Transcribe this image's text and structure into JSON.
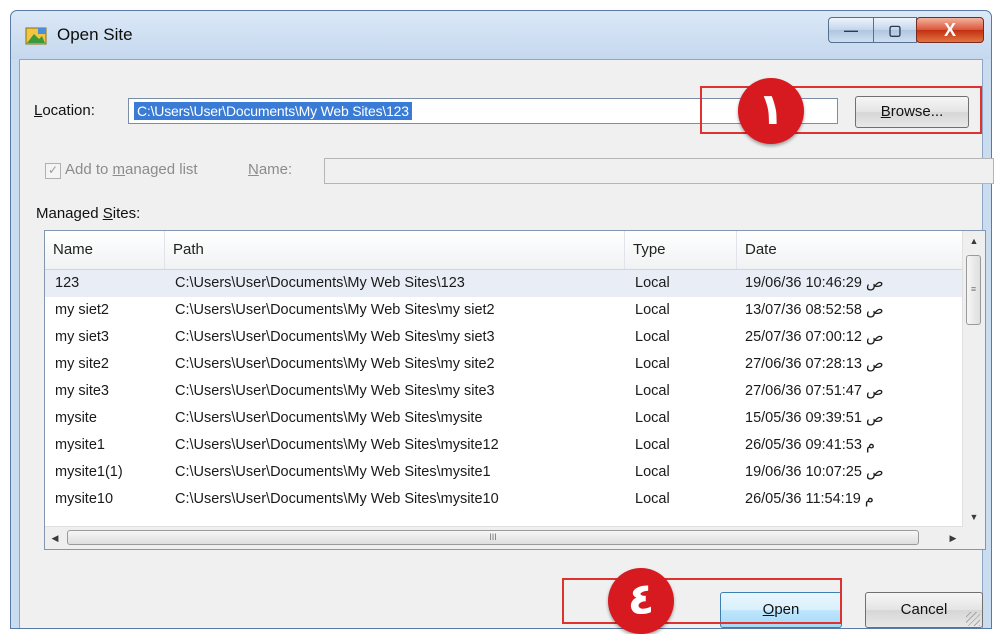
{
  "window": {
    "title": "Open Site",
    "controls": {
      "minimize": "—",
      "maximize": "▢",
      "close": "X"
    }
  },
  "location": {
    "label_accel": "L",
    "label_rest": "ocation:",
    "value": "C:\\Users\\User\\Documents\\My Web Sites\\123",
    "browse_accel": "B",
    "browse_rest": "rowse..."
  },
  "managed": {
    "check_mark": "✓",
    "add_pre": "Add to ",
    "add_accel": "m",
    "add_post": "anaged list",
    "name_accel": "N",
    "name_rest": "ame:",
    "sites_pre": "Managed ",
    "sites_accel": "S",
    "sites_post": "ites:"
  },
  "table": {
    "headers": {
      "name": "Name",
      "path": "Path",
      "type": "Type",
      "date": "Date"
    },
    "rows": [
      {
        "name": "123",
        "path": "C:\\Users\\User\\Documents\\My Web Sites\\123",
        "type": "Local",
        "date": "19/06/36 10:46:29 ص"
      },
      {
        "name": "my siet2",
        "path": "C:\\Users\\User\\Documents\\My Web Sites\\my siet2",
        "type": "Local",
        "date": "13/07/36 08:52:58 ص"
      },
      {
        "name": "my siet3",
        "path": "C:\\Users\\User\\Documents\\My Web Sites\\my siet3",
        "type": "Local",
        "date": "25/07/36 07:00:12 ص"
      },
      {
        "name": "my site2",
        "path": "C:\\Users\\User\\Documents\\My Web Sites\\my site2",
        "type": "Local",
        "date": "27/06/36 07:28:13 ص"
      },
      {
        "name": "my site3",
        "path": "C:\\Users\\User\\Documents\\My Web Sites\\my site3",
        "type": "Local",
        "date": "27/06/36 07:51:47 ص"
      },
      {
        "name": "mysite",
        "path": "C:\\Users\\User\\Documents\\My Web Sites\\mysite",
        "type": "Local",
        "date": "15/05/36 09:39:51 ص"
      },
      {
        "name": "mysite1",
        "path": "C:\\Users\\User\\Documents\\My Web Sites\\mysite12",
        "type": "Local",
        "date": "26/05/36 09:41:53 م"
      },
      {
        "name": "mysite1(1)",
        "path": "C:\\Users\\User\\Documents\\My Web Sites\\mysite1",
        "type": "Local",
        "date": "19/06/36 10:07:25 ص"
      },
      {
        "name": "mysite10",
        "path": "C:\\Users\\User\\Documents\\My Web Sites\\mysite10",
        "type": "Local",
        "date": "26/05/36 11:54:19 م"
      }
    ],
    "scroll": {
      "up": "▲",
      "down": "▼",
      "left": "◀",
      "right": "▶",
      "grip_v": "≡",
      "grip_h": "III"
    }
  },
  "buttons": {
    "open_accel": "O",
    "open_rest": "pen",
    "cancel": "Cancel"
  },
  "callouts": {
    "step1": "١",
    "step4": "٤"
  },
  "colors": {
    "callout_red": "#d71920",
    "selection_blue": "#3a7bd5",
    "title_bar": "#c9dcf0"
  }
}
